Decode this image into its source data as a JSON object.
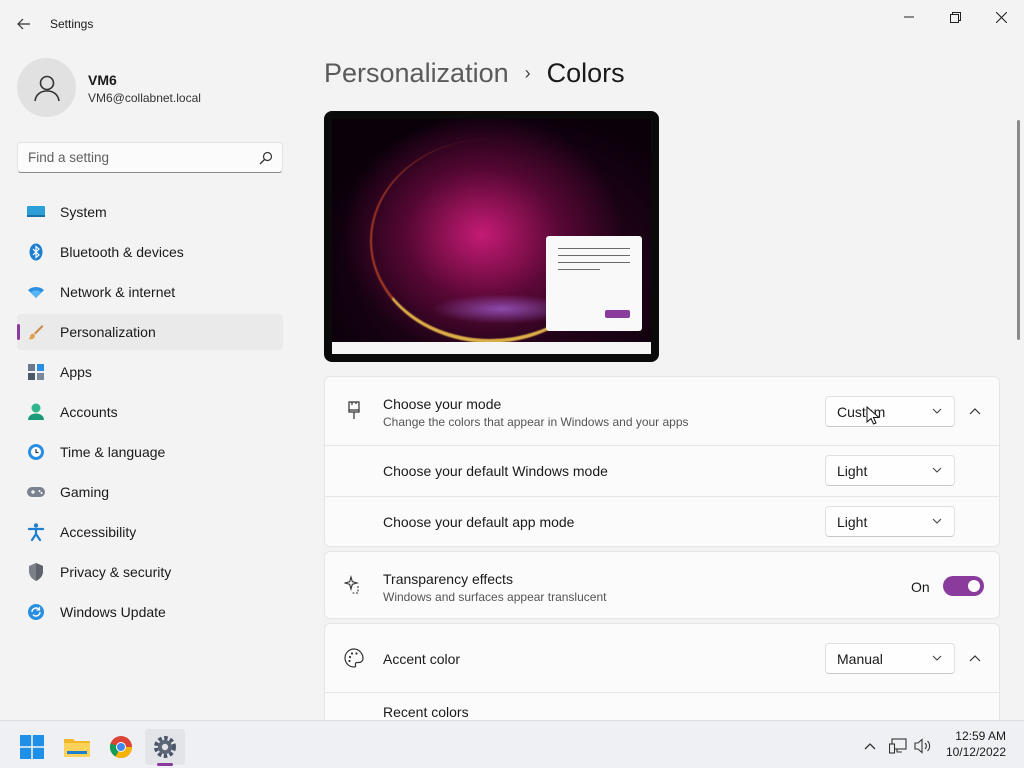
{
  "window": {
    "title": "Settings",
    "back_icon": "back-arrow-icon",
    "minimize_icon": "minimize-icon",
    "maximize_icon": "restore-icon",
    "close_icon": "close-icon"
  },
  "user": {
    "name": "VM6",
    "email": "VM6@collabnet.local",
    "avatar_icon": "user-avatar-icon"
  },
  "search": {
    "placeholder": "Find a setting",
    "icon": "search-icon"
  },
  "sidebar": {
    "items": [
      {
        "label": "System",
        "icon": "system-icon",
        "active": false
      },
      {
        "label": "Bluetooth & devices",
        "icon": "bluetooth-icon",
        "active": false
      },
      {
        "label": "Network & internet",
        "icon": "wifi-icon",
        "active": false
      },
      {
        "label": "Personalization",
        "icon": "brush-icon",
        "active": true
      },
      {
        "label": "Apps",
        "icon": "apps-icon",
        "active": false
      },
      {
        "label": "Accounts",
        "icon": "accounts-icon",
        "active": false
      },
      {
        "label": "Time & language",
        "icon": "time-language-icon",
        "active": false
      },
      {
        "label": "Gaming",
        "icon": "gamepad-icon",
        "active": false
      },
      {
        "label": "Accessibility",
        "icon": "accessibility-icon",
        "active": false
      },
      {
        "label": "Privacy & security",
        "icon": "shield-icon",
        "active": false
      },
      {
        "label": "Windows Update",
        "icon": "update-icon",
        "active": false
      }
    ]
  },
  "breadcrumb": {
    "parent": "Personalization",
    "separator": "›",
    "current": "Colors"
  },
  "settings": {
    "mode": {
      "title": "Choose your mode",
      "description": "Change the colors that appear in Windows and your apps",
      "value": "Custom",
      "icon": "paintbrush-icon"
    },
    "windows_mode": {
      "title": "Choose your default Windows mode",
      "value": "Light"
    },
    "app_mode": {
      "title": "Choose your default app mode",
      "value": "Light"
    },
    "transparency": {
      "title": "Transparency effects",
      "description": "Windows and surfaces appear translucent",
      "state_label": "On",
      "on": true,
      "icon": "sparkle-icon"
    },
    "accent": {
      "title": "Accent color",
      "value": "Manual",
      "icon": "palette-icon"
    },
    "recent_colors": {
      "title": "Recent colors"
    }
  },
  "taskbar": {
    "apps": [
      "start-icon",
      "file-explorer-icon",
      "chrome-icon",
      "settings-icon"
    ],
    "tray": [
      "chevron-up-icon",
      "network-icon",
      "volume-icon"
    ],
    "time": "12:59 AM",
    "date": "10/12/2022"
  },
  "colors": {
    "accent": "#8a3c9c",
    "background": "#f3f3f3",
    "card": "#fbfbfb"
  }
}
